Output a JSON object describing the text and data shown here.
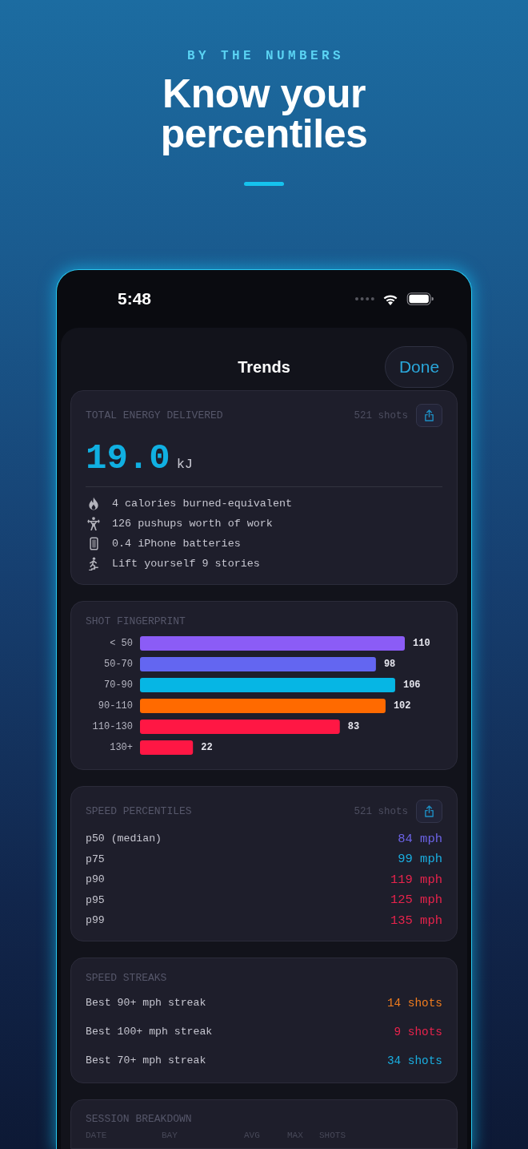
{
  "header": {
    "eyebrow": "BY THE NUMBERS",
    "title": "Know your percentiles"
  },
  "status_bar": {
    "time": "5:48"
  },
  "nav": {
    "title": "Trends",
    "done_button": "Done"
  },
  "energy_card": {
    "title": "TOTAL ENERGY DELIVERED",
    "shots": "521 shots",
    "value": "19.0",
    "unit": "kJ",
    "facts": [
      "4 calories burned-equivalent",
      "126 pushups worth of work",
      "0.4 iPhone batteries",
      "Lift yourself 9 stories"
    ]
  },
  "fingerprint": {
    "title": "SHOT FINGERPRINT",
    "chart_data": {
      "type": "bar",
      "orientation": "horizontal",
      "categories": [
        "< 50",
        "50-70",
        "70-90",
        "90-110",
        "110-130",
        "130+"
      ],
      "values": [
        110,
        98,
        106,
        102,
        83,
        22
      ],
      "data_labels": true,
      "colors": [
        "#8b5cf6",
        "#6366f1",
        "#06b6e4",
        "#ff6a00",
        "#ff1744",
        "#ff1744"
      ]
    }
  },
  "percentiles": {
    "title": "SPEED PERCENTILES",
    "shots": "521 shots",
    "rows": [
      {
        "label": "p50 (median)",
        "value": "84 mph",
        "color": "#6c63e6"
      },
      {
        "label": "p75",
        "value": "99 mph",
        "color": "#1aaee0"
      },
      {
        "label": "p90",
        "value": "119 mph",
        "color": "#e8234c"
      },
      {
        "label": "p95",
        "value": "125 mph",
        "color": "#e8234c"
      },
      {
        "label": "p99",
        "value": "135 mph",
        "color": "#e8234c"
      }
    ]
  },
  "streaks": {
    "title": "SPEED STREAKS",
    "rows": [
      {
        "label": "Best 90+ mph streak",
        "value": "14 shots",
        "color": "#f07c1e"
      },
      {
        "label": "Best 100+ mph streak",
        "value": "9 shots",
        "color": "#e8234c"
      },
      {
        "label": "Best 70+ mph streak",
        "value": "34 shots",
        "color": "#1aaee0"
      }
    ]
  },
  "session_breakdown": {
    "title": "SESSION BREAKDOWN",
    "columns": [
      "DATE",
      "BAY",
      "AVG",
      "MAX",
      "SHOTS"
    ]
  }
}
